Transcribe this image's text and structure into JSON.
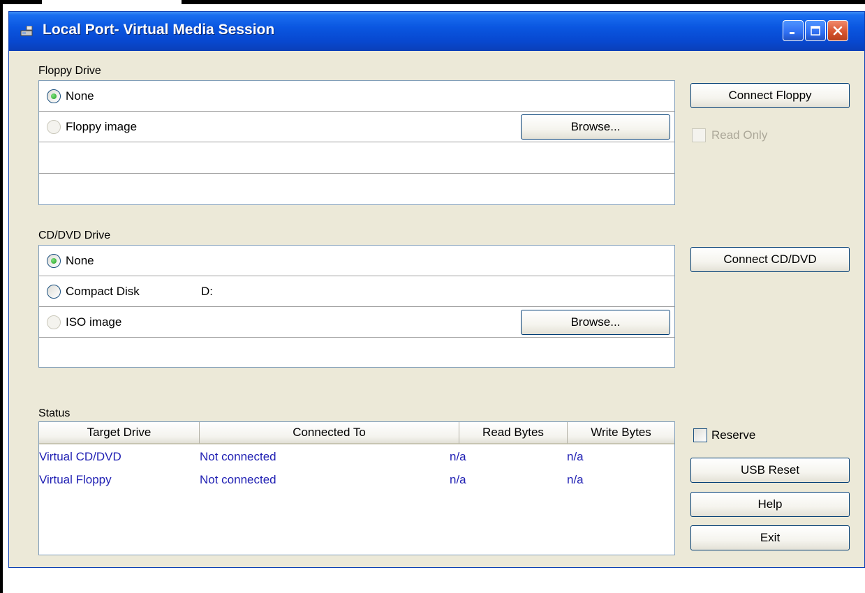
{
  "window": {
    "title": "Local Port- Virtual Media Session"
  },
  "floppy": {
    "group_label": "Floppy Drive",
    "options": [
      {
        "label": "None",
        "selected": true,
        "enabled": true
      },
      {
        "label": "Floppy image",
        "selected": false,
        "enabled": false
      }
    ],
    "browse_label": "Browse...",
    "connect_label": "Connect Floppy",
    "read_only_label": "Read Only"
  },
  "cd": {
    "group_label": "CD/DVD Drive",
    "options": [
      {
        "label": "None",
        "selected": true,
        "enabled": true
      },
      {
        "label": "Compact Disk",
        "drive": "D:",
        "selected": false,
        "enabled": true
      },
      {
        "label": "ISO image",
        "selected": false,
        "enabled": false
      }
    ],
    "browse_label": "Browse...",
    "connect_label": "Connect CD/DVD"
  },
  "status": {
    "group_label": "Status",
    "columns": [
      "Target Drive",
      "Connected To",
      "Read Bytes",
      "Write Bytes"
    ],
    "rows": [
      [
        "Virtual CD/DVD",
        "Not connected",
        "n/a",
        "n/a"
      ],
      [
        "Virtual Floppy",
        "Not connected",
        "n/a",
        "n/a"
      ]
    ]
  },
  "side": {
    "reserve_label": "Reserve",
    "usb_reset_label": "USB Reset",
    "help_label": "Help",
    "exit_label": "Exit"
  },
  "colors": {
    "titlebar": "#0a56e0",
    "window_bg": "#ece9d8",
    "link_text": "#1f1fb3",
    "radio_selected": "#21a121"
  }
}
